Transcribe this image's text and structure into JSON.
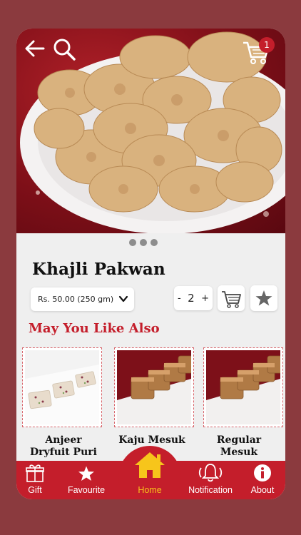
{
  "header": {
    "cart_count": "1"
  },
  "product": {
    "title": "Khajli Pakwan",
    "price_option": "Rs. 50.00 (250 gm)",
    "quantity": "2",
    "qty_minus": "-",
    "qty_plus": "+"
  },
  "carousel": {
    "slides": 3,
    "active": 0
  },
  "recommend": {
    "title": "May You Like Also",
    "items": [
      {
        "name_line1": "Anjeer",
        "name_line2": "Dryfuit Puri"
      },
      {
        "name_line1": "Kaju Mesuk",
        "name_line2": ""
      },
      {
        "name_line1": "Regular",
        "name_line2": "Mesuk"
      }
    ]
  },
  "nav": {
    "items": [
      {
        "label": "Gift",
        "icon": "gift-icon"
      },
      {
        "label": "Favourite",
        "icon": "star-icon"
      },
      {
        "label": "Home",
        "icon": "home-icon",
        "active": true
      },
      {
        "label": "Notification",
        "icon": "bell-icon"
      },
      {
        "label": "About",
        "icon": "info-icon"
      }
    ]
  },
  "colors": {
    "brand": "#c41e2b",
    "background": "#8b3a3e",
    "active_nav": "#f7c51b"
  }
}
